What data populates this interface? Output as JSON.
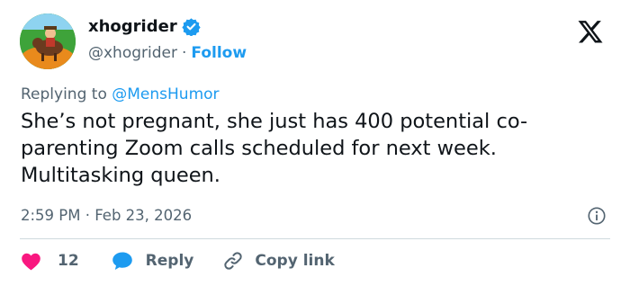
{
  "author": {
    "display_name": "xhogrider",
    "handle": "@xhogrider",
    "separator": "·",
    "follow_label": "Follow",
    "verified_color": "#1d9bf0"
  },
  "replying": {
    "prefix": "Replying to",
    "mention": "@MensHumor"
  },
  "tweet": {
    "text": "She’s not pregnant, she just has 400 potential co-parenting Zoom calls scheduled for next week. Multitasking queen.",
    "timestamp": "2:59 PM · Feb 23, 2026"
  },
  "actions": {
    "like_count": "12",
    "reply_label": "Reply",
    "copy_link_label": "Copy link"
  },
  "icons": {
    "like": "heart-icon",
    "reply": "speech-bubble-icon",
    "copy": "link-icon",
    "info": "info-icon",
    "brand": "x-logo-icon",
    "verified": "verified-badge-icon"
  },
  "colors": {
    "accent": "#1d9bf0",
    "like": "#f91880",
    "muted": "#536471",
    "text": "#0f1419"
  }
}
